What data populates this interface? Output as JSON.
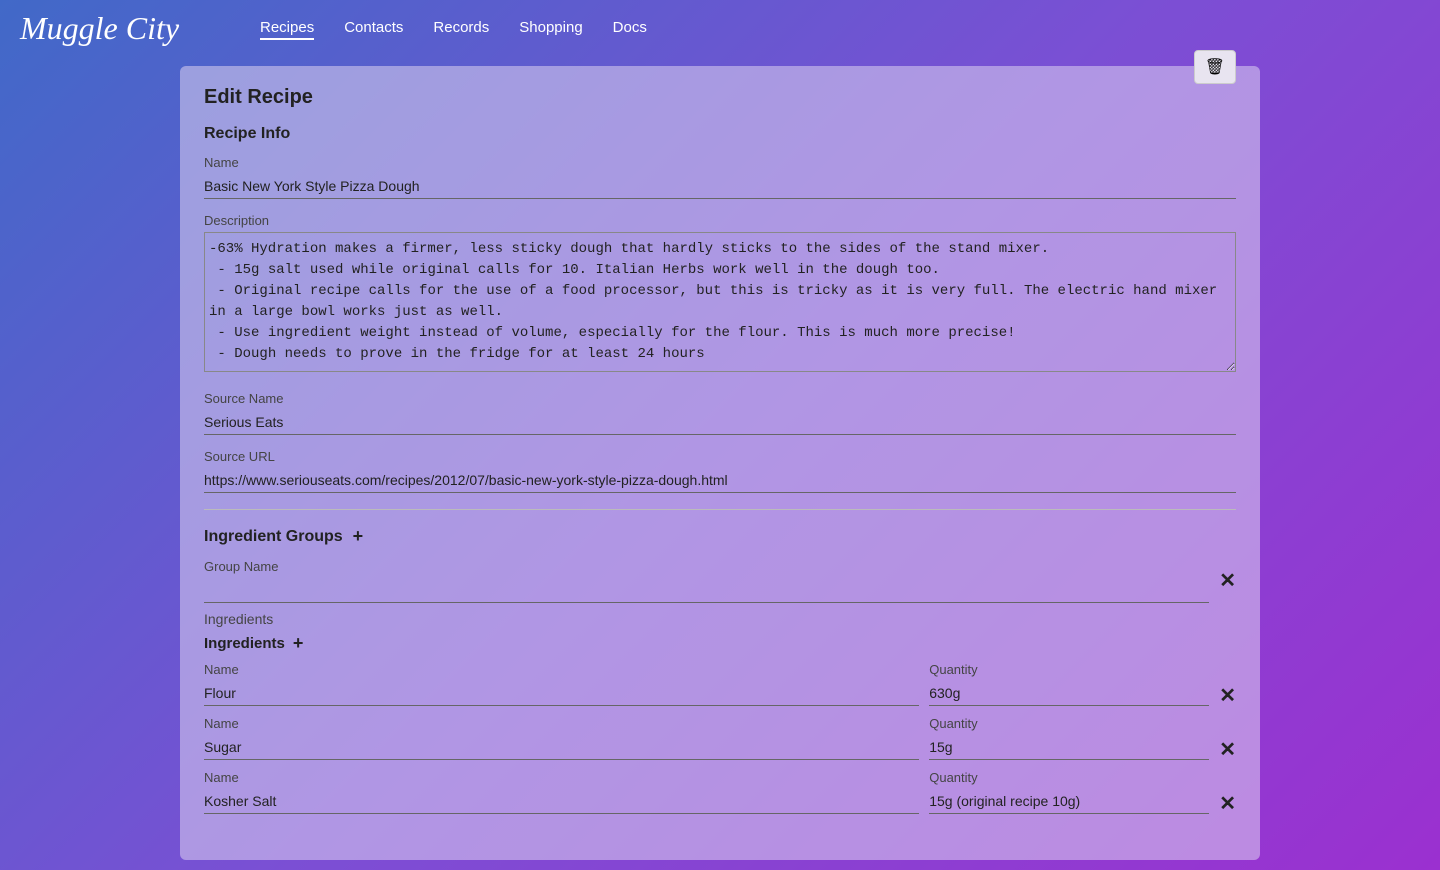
{
  "brand": "Muggle City",
  "nav": {
    "items": [
      {
        "label": "Recipes",
        "active": true
      },
      {
        "label": "Contacts",
        "active": false
      },
      {
        "label": "Records",
        "active": false
      },
      {
        "label": "Shopping",
        "active": false
      },
      {
        "label": "Docs",
        "active": false
      }
    ]
  },
  "page": {
    "title": "Edit Recipe",
    "delete_label": "🗑",
    "recipe_info_label": "Recipe Info",
    "name_label": "Name",
    "name_value": "Basic New York Style Pizza Dough",
    "description_label": "Description",
    "description_value": "-63% Hydration makes a firmer, less sticky dough that hardly sticks to the sides of the stand mixer.\n - 15g salt used while original calls for 10. Italian Herbs work well in the dough too.\n - Original recipe calls for the use of a food processor, but this is tricky as it is very full. The electric hand mixer in a large bowl works just as well.\n - Use ingredient weight instead of volume, especially for the flour. This is much more precise!\n - Dough needs to prove in the fridge for at least 24 hours",
    "source_name_label": "Source Name",
    "source_name_value": "Serious Eats",
    "source_url_label": "Source URL",
    "source_url_value": "https://www.seriouseats.com/recipes/2012/07/basic-new-york-style-pizza-dough.html",
    "ingredient_groups_label": "Ingredient Groups",
    "add_group_icon": "+",
    "group_name_label": "Group Name",
    "group_name_value": "",
    "ingredients_label": "Ingredients",
    "ingredients_subheader": "Ingredients",
    "add_ingredient_icon": "+",
    "remove_group_icon": "✕",
    "ingredient_rows": [
      {
        "name_label": "Name",
        "name_value": "Flour",
        "qty_label": "Quantity",
        "qty_value": "630g"
      },
      {
        "name_label": "Name",
        "name_value": "Sugar",
        "qty_label": "Quantity",
        "qty_value": "15g"
      },
      {
        "name_label": "Name",
        "name_value": "Kosher Salt",
        "qty_label": "Quantity",
        "qty_value": "15g (original recipe 10g)"
      }
    ],
    "remove_ingredient_icon": "✕"
  }
}
